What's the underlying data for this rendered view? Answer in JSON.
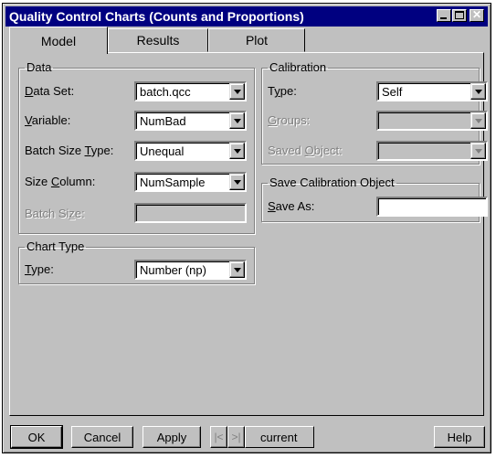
{
  "window": {
    "title": "Quality Control Charts (Counts and Proportions)"
  },
  "tabs": [
    {
      "label": "Model"
    },
    {
      "label": "Results"
    },
    {
      "label": "Plot"
    }
  ],
  "data_group": {
    "legend": "Data",
    "data_set": {
      "label_pre": "",
      "label_u": "D",
      "label_post": "ata Set:",
      "value": "batch.qcc"
    },
    "variable": {
      "label_pre": "",
      "label_u": "V",
      "label_post": "ariable:",
      "value": "NumBad"
    },
    "batch_size_type": {
      "label_pre": "Batch Size ",
      "label_u": "T",
      "label_post": "ype:",
      "value": "Unequal"
    },
    "size_column": {
      "label_pre": "Size ",
      "label_u": "C",
      "label_post": "olumn:",
      "value": "NumSample"
    },
    "batch_size": {
      "label_pre": "Batch Si",
      "label_u": "z",
      "label_post": "e:",
      "value": ""
    }
  },
  "chart_type_group": {
    "legend": "Chart Type",
    "type": {
      "label_pre": "",
      "label_u": "T",
      "label_post": "ype:",
      "value": "Number (np)"
    }
  },
  "calibration_group": {
    "legend": "Calibration",
    "type": {
      "label_pre": "T",
      "label_u": "y",
      "label_post": "pe:",
      "value": "Self"
    },
    "groups": {
      "label_pre": "",
      "label_u": "G",
      "label_post": "roups:",
      "value": ""
    },
    "saved_object": {
      "label_pre": "Saved ",
      "label_u": "O",
      "label_post": "bject:",
      "value": ""
    }
  },
  "save_group": {
    "legend": "Save Calibration Object",
    "save_as": {
      "label_pre": "",
      "label_u": "S",
      "label_post": "ave As:",
      "value": ""
    }
  },
  "footer": {
    "ok": "OK",
    "cancel": "Cancel",
    "apply": "Apply",
    "prev": "|<",
    "next": ">|",
    "current": "current",
    "help": "Help"
  }
}
